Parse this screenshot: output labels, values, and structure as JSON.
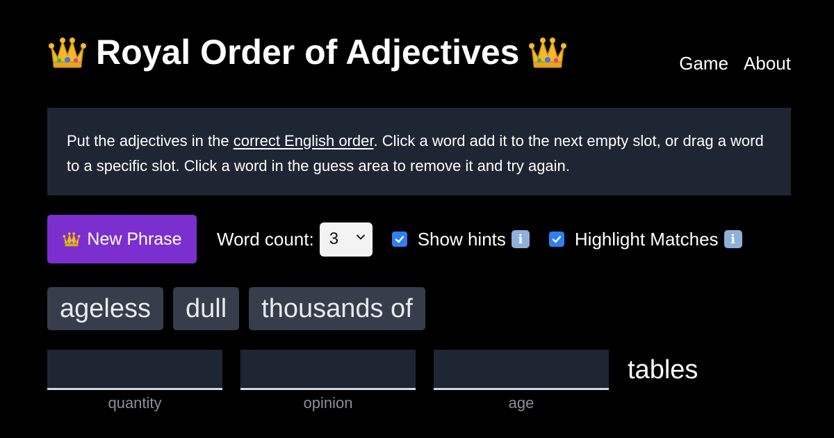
{
  "header": {
    "title": "Royal Order of Adjectives",
    "nav": [
      "Game",
      "About"
    ]
  },
  "instructions": {
    "before_link": "Put the adjectives in the ",
    "link_text": "correct English order",
    "after_link": ". Click a word add it to the next empty slot, or drag a word to a specific slot. Click a word in the guess area to remove it and try again."
  },
  "controls": {
    "new_phrase_label": "New Phrase",
    "word_count_label": "Word count:",
    "word_count_value": "3",
    "show_hints_label": "Show hints",
    "show_hints_checked": true,
    "highlight_matches_label": "Highlight Matches",
    "highlight_matches_checked": true
  },
  "word_bank": [
    "ageless",
    "dull",
    "thousands of"
  ],
  "slots": [
    {
      "label": "quantity",
      "value": ""
    },
    {
      "label": "opinion",
      "value": ""
    },
    {
      "label": "age",
      "value": ""
    }
  ],
  "noun": "tables",
  "colors": {
    "background": "#000000",
    "panel": "#1f2633",
    "button": "#7b2fcf",
    "word_tile": "#373d4b",
    "checkbox": "#2f7ff0",
    "slot_label": "#8a8f98"
  },
  "icons": {
    "crown": "crown-icon",
    "info": "info-icon",
    "chevron": "chevron-down-icon",
    "check": "checkmark-icon"
  }
}
